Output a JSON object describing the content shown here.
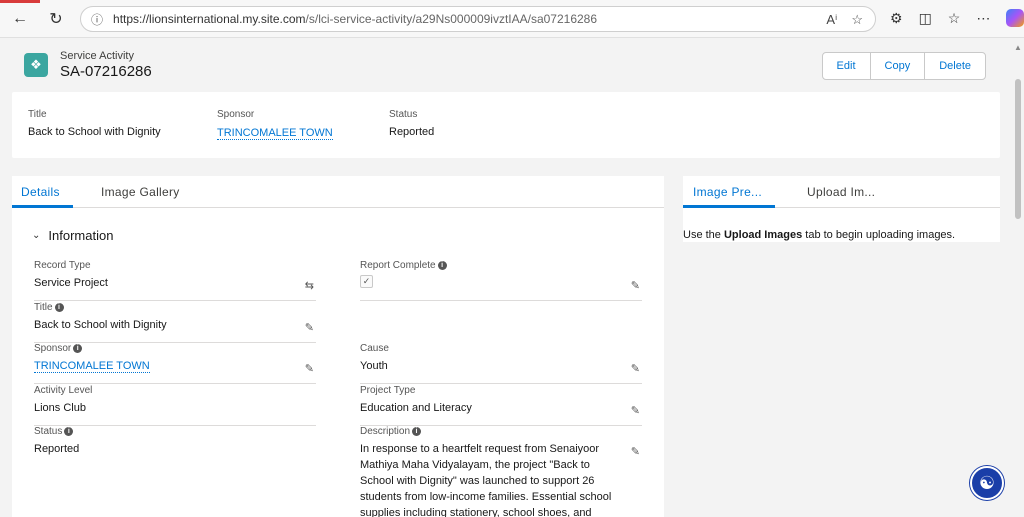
{
  "browser": {
    "url_host": "https://lionsinternational.my.site.com",
    "url_path": "/s/lci-service-activity/a29Ns000009ivztIAA/sa07216286"
  },
  "record": {
    "object_type": "Service Activity",
    "name": "SA-07216286",
    "actions": {
      "edit": "Edit",
      "copy": "Copy",
      "delete": "Delete"
    }
  },
  "highlights": {
    "title_label": "Title",
    "title_value": "Back to School with Dignity",
    "sponsor_label": "Sponsor",
    "sponsor_value": "TRINCOMALEE TOWN",
    "status_label": "Status",
    "status_value": "Reported"
  },
  "tabs": {
    "details": "Details",
    "gallery": "Image Gallery"
  },
  "section": {
    "title": "Information"
  },
  "fields": {
    "record_type_label": "Record Type",
    "record_type_value": "Service Project",
    "report_complete_label": "Report Complete",
    "title_label": "Title",
    "title_value": "Back to School with Dignity",
    "sponsor_label": "Sponsor",
    "sponsor_value": "TRINCOMALEE TOWN",
    "cause_label": "Cause",
    "cause_value": "Youth",
    "activity_level_label": "Activity Level",
    "activity_level_value": "Lions Club",
    "project_type_label": "Project Type",
    "project_type_value": "Education and Literacy",
    "status_label": "Status",
    "status_value": "Reported",
    "description_label": "Description",
    "description_value": "In response to a heartfelt request from Senaiyoor Mathiya Maha Vidyalayam, the project \"Back to School with Dignity\" was launched to support 26 students from low-income families. Essential school supplies including stationery, school shoes, and"
  },
  "right_panel": {
    "tab_preview": "Image Pre...",
    "tab_upload": "Upload Im...",
    "msg_prefix": "Use the ",
    "msg_bold": "Upload Images",
    "msg_suffix": " tab to begin uploading images."
  }
}
